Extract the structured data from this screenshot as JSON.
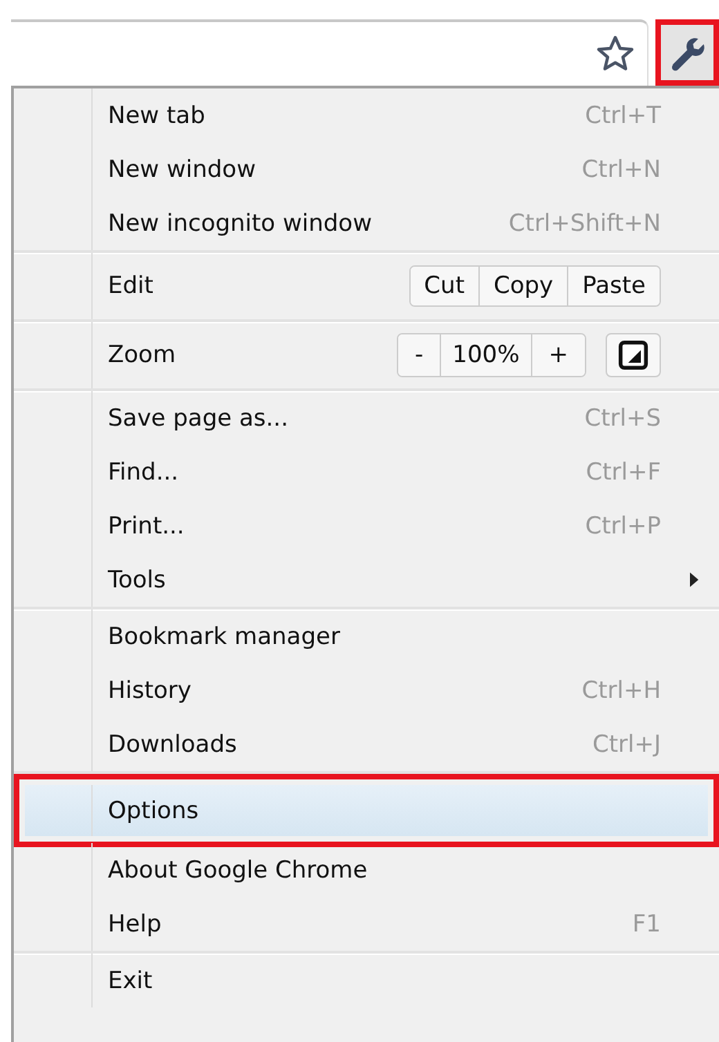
{
  "toolbar": {
    "menu_button_marked": true
  },
  "menu": {
    "groups": [
      [
        {
          "kind": "command",
          "label": "New tab",
          "shortcut": "Ctrl+T",
          "selected": false
        },
        {
          "kind": "command",
          "label": "New window",
          "shortcut": "Ctrl+N",
          "selected": false
        },
        {
          "kind": "command",
          "label": "New incognito window",
          "shortcut": "Ctrl+Shift+N",
          "selected": false
        }
      ],
      [
        {
          "kind": "edit",
          "label": "Edit",
          "buttons": [
            "Cut",
            "Copy",
            "Paste"
          ],
          "selected": false
        }
      ],
      [
        {
          "kind": "zoom",
          "label": "Zoom",
          "minus": "-",
          "value": "100%",
          "plus": "+",
          "selected": false
        }
      ],
      [
        {
          "kind": "command",
          "label": "Save page as...",
          "shortcut": "Ctrl+S",
          "selected": false
        },
        {
          "kind": "command",
          "label": "Find...",
          "shortcut": "Ctrl+F",
          "selected": false
        },
        {
          "kind": "command",
          "label": "Print...",
          "shortcut": "Ctrl+P",
          "selected": false
        },
        {
          "kind": "submenu",
          "label": "Tools",
          "selected": false
        }
      ],
      [
        {
          "kind": "command",
          "label": "Bookmark manager",
          "selected": false
        },
        {
          "kind": "command",
          "label": "History",
          "shortcut": "Ctrl+H",
          "selected": false
        },
        {
          "kind": "command",
          "label": "Downloads",
          "shortcut": "Ctrl+J",
          "selected": false
        }
      ],
      [
        {
          "kind": "command",
          "label": "Options",
          "selected": true
        },
        {
          "kind": "command",
          "label": "About Google Chrome",
          "selected": false
        },
        {
          "kind": "command",
          "label": "Help",
          "shortcut": "F1",
          "selected": false
        }
      ],
      [
        {
          "kind": "command",
          "label": "Exit",
          "selected": false
        }
      ]
    ]
  }
}
